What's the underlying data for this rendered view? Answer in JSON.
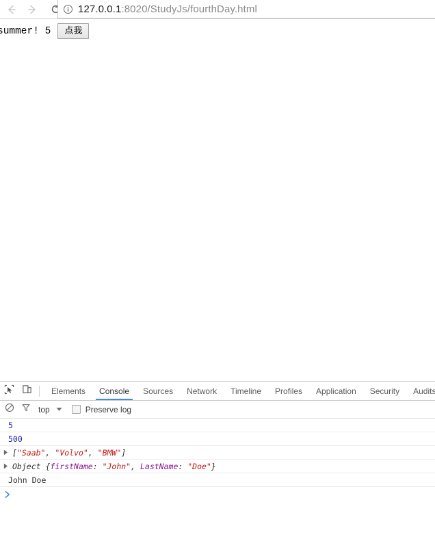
{
  "browser": {
    "back_icon": "arrow-left-icon",
    "forward_icon": "arrow-right-icon",
    "reload_icon": "reload-icon",
    "security_icon": "info-circle-icon",
    "url_host": "127.0.0.1",
    "url_rest": ":8020/StudyJs/fourthDay.html",
    "url_full": "127.0.0.1:8020/StudyJs/fourthDay.html"
  },
  "page": {
    "body_text": "summer! 5",
    "button_label": "点我"
  },
  "devtools": {
    "inspect_icon": "inspect-element-icon",
    "device_icon": "device-toolbar-icon",
    "tabs": [
      {
        "label": "Elements",
        "active": false
      },
      {
        "label": "Console",
        "active": true
      },
      {
        "label": "Sources",
        "active": false
      },
      {
        "label": "Network",
        "active": false
      },
      {
        "label": "Timeline",
        "active": false
      },
      {
        "label": "Profiles",
        "active": false
      },
      {
        "label": "Application",
        "active": false
      },
      {
        "label": "Security",
        "active": false
      },
      {
        "label": "Audits",
        "active": false
      }
    ],
    "filterbar": {
      "clear_icon": "clear-console-icon",
      "filter_icon": "filter-funnel-icon",
      "context_label": "top",
      "context_caret_icon": "chevron-down-icon",
      "preserve_log_label": "Preserve log",
      "preserve_log_checked": false
    },
    "console": {
      "messages": [
        {
          "id": "msg-number-5",
          "kind": "number",
          "expandable": false,
          "text": "5"
        },
        {
          "id": "msg-number-500",
          "kind": "number",
          "expandable": false,
          "text": "500"
        },
        {
          "id": "msg-array-cars",
          "kind": "array",
          "expandable": true,
          "text": "[\"Saab\", \"Volvo\", \"BMW\"]",
          "open_bracket": "[",
          "items": [
            "\"Saab\"",
            "\"Volvo\"",
            "\"BMW\""
          ],
          "close_bracket": "]"
        },
        {
          "id": "msg-object-person",
          "kind": "object",
          "expandable": true,
          "text": "Object {firstName: \"John\", LastName: \"Doe\"}",
          "label": "Object ",
          "open_brace": "{",
          "entries": [
            {
              "key": "firstName",
              "value": "\"John\""
            },
            {
              "key": "LastName",
              "value": "\"Doe\""
            }
          ],
          "close_brace": "}"
        },
        {
          "id": "msg-string-johndoe",
          "kind": "string",
          "expandable": false,
          "text": "John Doe"
        }
      ],
      "prompt_caret": "chevron-right-icon",
      "prompt_value": ""
    }
  },
  "colors": {
    "accent": "#4285f4",
    "number": "#1a1aa6",
    "string": "#c41a16",
    "key": "#881391",
    "text": "#303030"
  }
}
